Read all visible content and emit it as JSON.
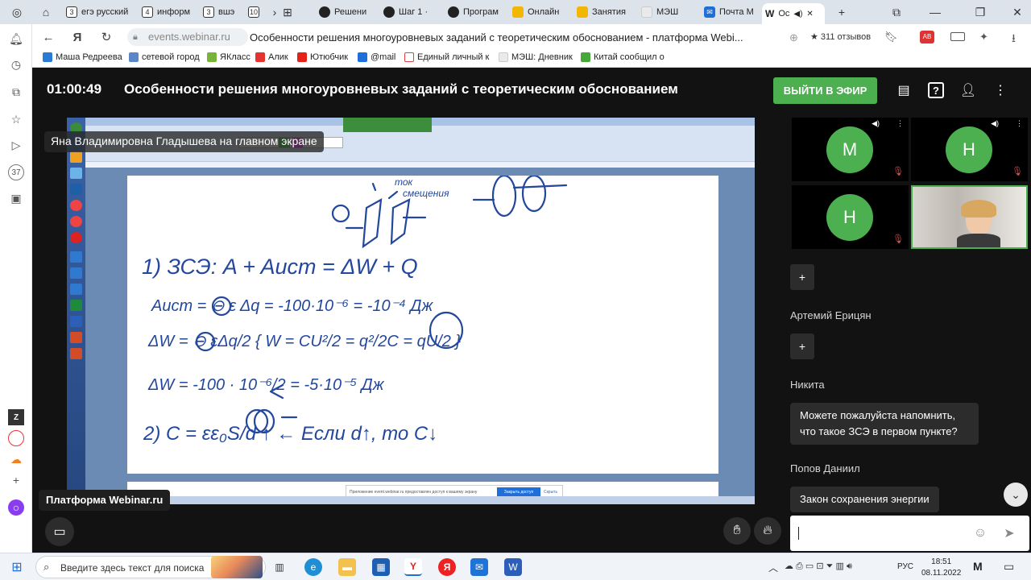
{
  "tabs": [
    {
      "num": "3",
      "label": "егэ русский"
    },
    {
      "num": "4",
      "label": "информ"
    },
    {
      "num": "3",
      "label": "вшэ"
    },
    {
      "num": "10",
      "label": ""
    },
    {
      "label": "Решени"
    },
    {
      "label": "Шаг 1 ·"
    },
    {
      "label": "Програм"
    },
    {
      "label": "Онлайн"
    },
    {
      "label": "Занятия"
    },
    {
      "label": "МЭШ"
    },
    {
      "label": "Почта М"
    },
    {
      "label": "Ос"
    }
  ],
  "address": {
    "url": "events.webinar.ru",
    "page_title": "Особенности решения многоуровневых заданий с теоретическим обоснованием - платформа Webi...",
    "reviews": "311 отзывов"
  },
  "bookmarks": [
    {
      "label": "Маша Редреева",
      "color": "#2a7bd6"
    },
    {
      "label": "сетевой город",
      "color": "#5b86c8"
    },
    {
      "label": "ЯКласс",
      "color": "#7ab33b"
    },
    {
      "label": "Алик",
      "color": "#e3342f"
    },
    {
      "label": "Ютюбчик",
      "color": "#e62117"
    },
    {
      "label": "@mail",
      "color": "#1e6fd9"
    },
    {
      "label": "Единый личный к",
      "color": "#d44"
    },
    {
      "label": "МЭШ: Дневник",
      "color": "#cfd5dc"
    },
    {
      "label": "Китай сообщил о",
      "color": "#46a83a"
    }
  ],
  "webinar": {
    "time": "01:00:49",
    "title": "Особенности решения многоуровневых заданий с теоретическим обоснованием",
    "go_live": "ВЫЙТИ В ЭФИР"
  },
  "screen": {
    "presenter_label": "Яна Владимировна Гладышева на главном экране",
    "platform_label": "Платформа Webinar.ru",
    "share_notice": "Приложение event.webinar.ru предоставлен доступ к вашему экрану",
    "share_stop": "Закрыть доступ",
    "share_hide": "Скрыть"
  },
  "notes": {
    "top_words": [
      "ток",
      "смещения"
    ],
    "line1": "1)  ЗСЭ:   A + Aист = ΔW + Q",
    "line2": "Aист = ⊖ ε Δq = -100·10⁻⁶ = -10⁻⁴ Дж",
    "line3": "ΔW = ⊖ εΔq/2   { W = CU²/2 = q²/2C = qU/2 }",
    "line4": "ΔW = -100 · 10⁻⁶/2 = -5·10⁻⁵ Дж",
    "line5": "2)  C = εε₀S/d ↑   ←   Если d↑, то C↓"
  },
  "participants": [
    {
      "initial": "М",
      "color": "#4caf50"
    },
    {
      "initial": "Н",
      "color": "#4caf50"
    },
    {
      "initial": "Н",
      "color": "#4caf50"
    }
  ],
  "chat": {
    "plus": "+",
    "messages": [
      {
        "author": "Артемий Ерицян",
        "text": ""
      },
      {
        "author": "Никита",
        "text": "Можете пожалуйста напомнить, что такое ЗСЭ в первом пункте?"
      },
      {
        "author": "Попов Даниил",
        "text": "Закон сохранения энергии"
      }
    ]
  },
  "taskbar": {
    "search_placeholder": "Введите здесь текст для поиска",
    "lang": "РУС",
    "time": "18:51",
    "date": "08.11.2022"
  },
  "icons": {
    "accent": "#4caf50",
    "mute_color": "#d84b4b"
  }
}
